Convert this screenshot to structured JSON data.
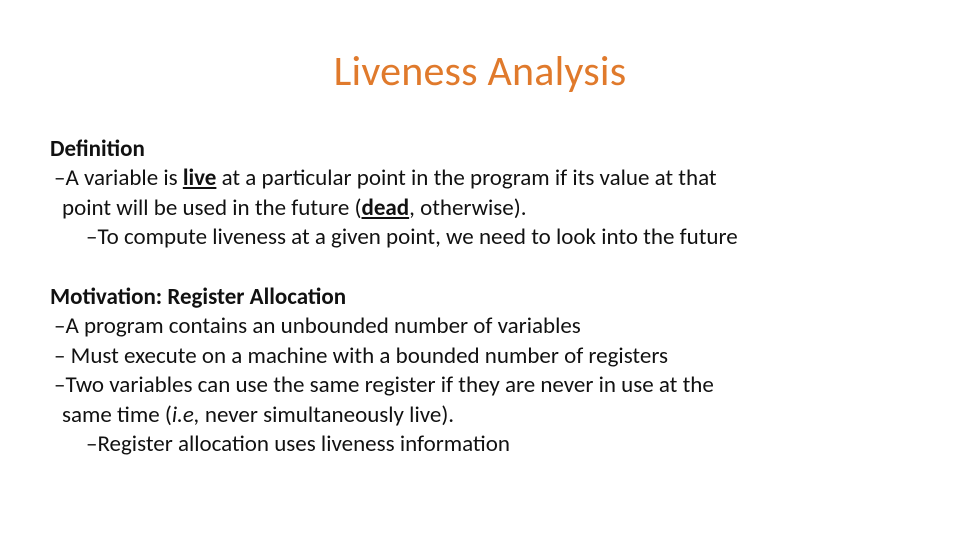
{
  "title": "Liveness Analysis",
  "def": {
    "label": "Definition",
    "l1a": "–A variable is ",
    "l1b_live": "live",
    "l1c": " at a particular point in the program if its value at that",
    "l2a": "point will be used in the future (",
    "l2b_dead": "dead",
    "l2c": ", otherwise).",
    "l3": "–To compute liveness at a given point, we need to look into the future"
  },
  "mot": {
    "label": "Motivation:  Register Allocation",
    "l1": "–A program contains an unbounded number of variables",
    "l2": "– Must execute on a machine with a bounded number of registers",
    "l3a": "–Two variables can use the same register if they are never in use at the",
    "l3b": "same  time (",
    "l3c_ie": "i.e,",
    "l3d": " never simultaneously live).",
    "l4": "–Register allocation uses liveness information"
  }
}
